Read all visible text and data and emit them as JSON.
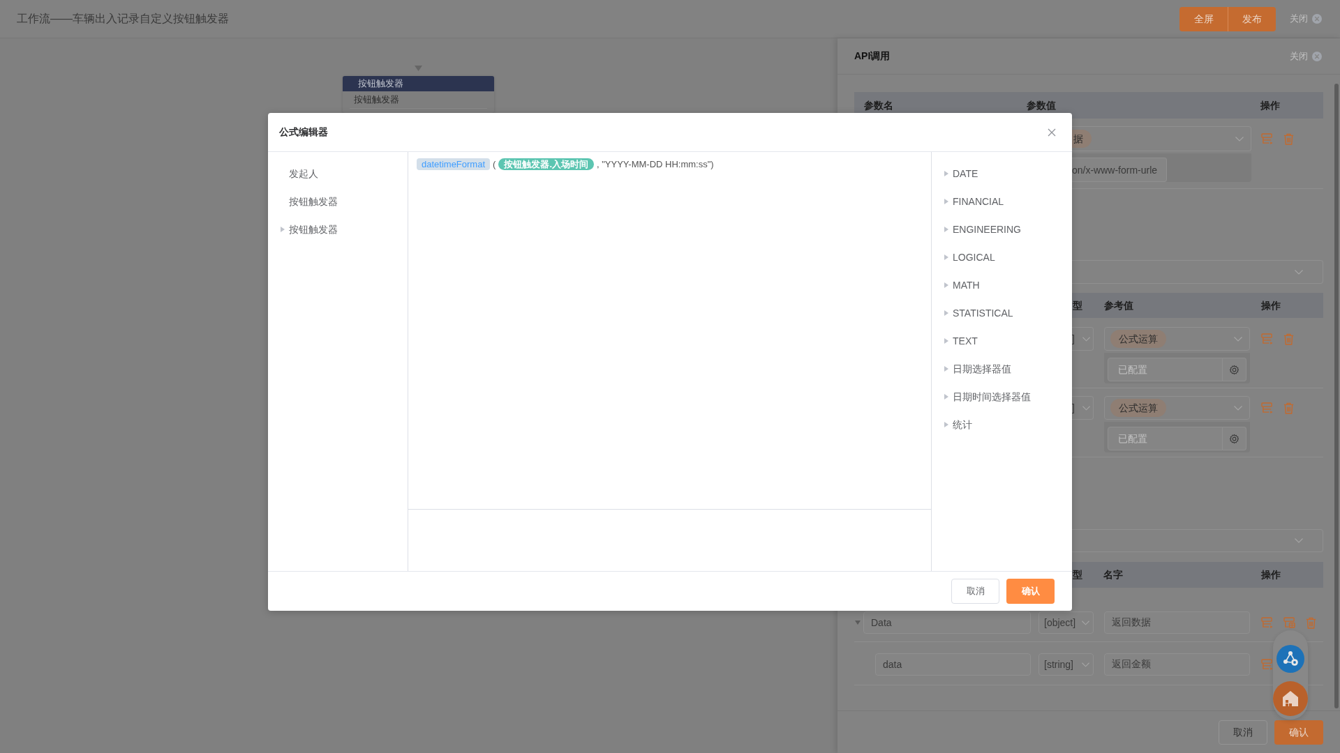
{
  "top_bar": {
    "title": "工作流——车辆出入记录自定义按钮触发器",
    "buttons": [
      "全屏",
      "发布"
    ],
    "close": "关闭"
  },
  "canvas": {
    "node": {
      "title": "按钮触发器",
      "item": "按钮触发器"
    }
  },
  "api_panel": {
    "title": "API调用",
    "close": "关闭",
    "params": {
      "columns": [
        "参数名",
        "参数值",
        "操作"
      ],
      "rows": [
        {
          "value_tag": "据",
          "content_type": "on/x-www-form-urle"
        }
      ]
    },
    "body": {
      "columns": [
        "型",
        "参考值",
        "操作"
      ],
      "rows": [
        {
          "type": "]",
          "value_tag": "公式运算",
          "placeholder": "已配置"
        },
        {
          "type": "]",
          "value_tag": "公式运算",
          "placeholder": "已配置"
        }
      ]
    },
    "response": {
      "columns": [
        "型",
        "名字",
        "操作"
      ],
      "rows": [
        {
          "kind": "object",
          "expanded": true,
          "name": "Data",
          "type": "[object]",
          "label": "返回数据",
          "children": [
            {
              "kind": "field",
              "name": "data",
              "type": "[string]",
              "label": "返回金额"
            }
          ]
        }
      ]
    },
    "buttons": [
      {
        "label": "取消",
        "kind": "default"
      },
      {
        "label": "确认",
        "kind": "primary"
      }
    ]
  },
  "formula_dialog": {
    "title": "公式编辑器",
    "variables": [
      {
        "label": "发起人",
        "kind": "leaf"
      },
      {
        "label": "按钮触发器",
        "kind": "leaf"
      },
      {
        "label": "按钮触发器",
        "kind": "group",
        "expanded": false
      }
    ],
    "formula": [
      {
        "kind": "function",
        "text": "datetimeFormat"
      },
      {
        "kind": "text",
        "text": "("
      },
      {
        "kind": "field",
        "text": "按钮触发器.入场时间"
      },
      {
        "kind": "text",
        "text": ", \"YYYY-MM-DD HH:mm:ss\")"
      }
    ],
    "functions": [
      {
        "label": "DATE",
        "expanded": false
      },
      {
        "label": "FINANCIAL",
        "expanded": false
      },
      {
        "label": "ENGINEERING",
        "expanded": false
      },
      {
        "label": "LOGICAL",
        "expanded": false
      },
      {
        "label": "MATH",
        "expanded": false
      },
      {
        "label": "STATISTICAL",
        "expanded": false
      },
      {
        "label": "TEXT",
        "expanded": false
      },
      {
        "label": "日期选择器值",
        "expanded": false
      },
      {
        "label": "日期时间选择器值",
        "expanded": false
      },
      {
        "label": "统计",
        "expanded": false
      }
    ],
    "buttons": [
      {
        "label": "取消",
        "kind": "default"
      },
      {
        "label": "确认",
        "kind": "primary"
      }
    ]
  }
}
